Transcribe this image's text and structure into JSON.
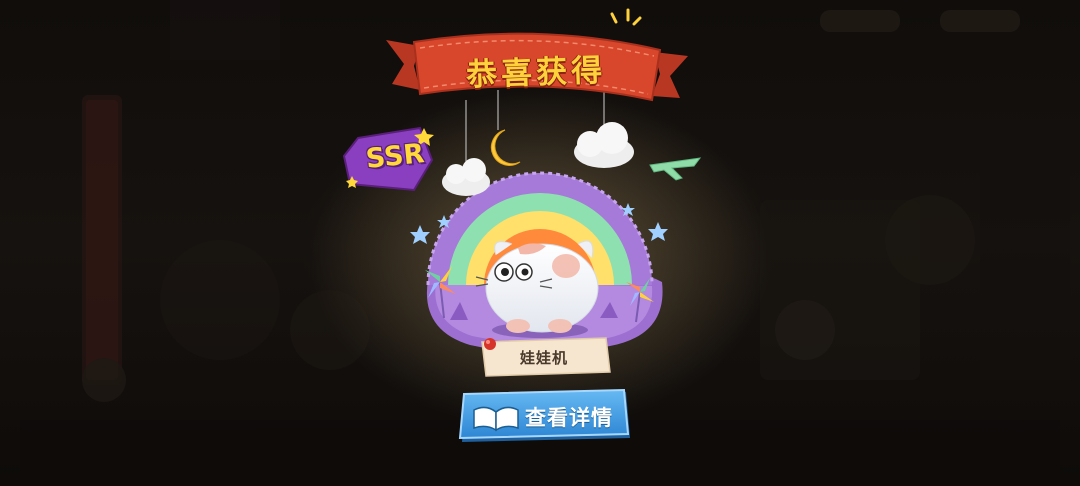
{
  "reward_dialog": {
    "title": "恭喜获得",
    "rarity_badge": "SSR",
    "item_name": "娃娃机",
    "details_button_label": "查看详情"
  },
  "icons": {
    "rarity": "ssr-star-badge-icon",
    "moon": "crescent-moon-icon",
    "clouds": "cloud-icon",
    "airplane": "paper-airplane-icon",
    "pinwheel": "pinwheel-icon",
    "stars": "star-icon",
    "pin": "red-pushpin-icon",
    "book": "open-book-icon",
    "creature": "round-cat-creature-icon"
  },
  "colors": {
    "banner_red": "#d8462c",
    "banner_text": "#ffd23c",
    "rainbow_purple": "#b58be0",
    "rainbow_green": "#8fe0b0",
    "rainbow_yellow": "#ffe06a",
    "rainbow_orange": "#ff8a3c",
    "button_blue": "#3d9be3",
    "label_paper": "#f6e6cf"
  }
}
